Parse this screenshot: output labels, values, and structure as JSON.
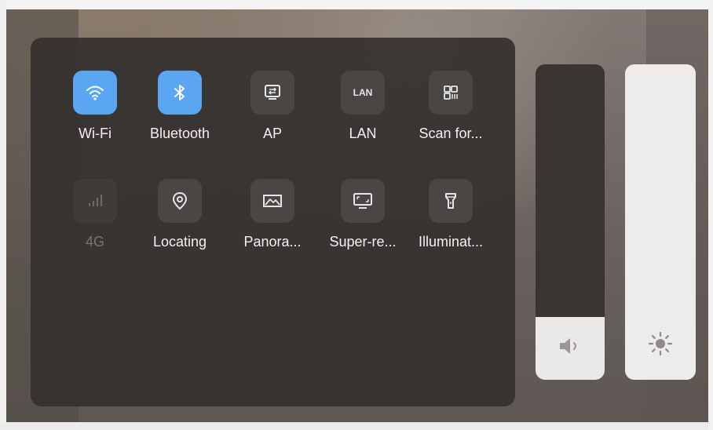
{
  "tiles": [
    {
      "name": "Wi-Fi",
      "icon": "wifi-icon",
      "active": true
    },
    {
      "name": "Bluetooth",
      "icon": "bluetooth-icon",
      "active": true
    },
    {
      "name": "AP",
      "icon": "hotspot-icon",
      "active": false
    },
    {
      "name": "LAN",
      "icon": "lan-icon",
      "icon_text": "LAN",
      "active": false
    },
    {
      "name": "Scan for...",
      "icon": "qr-scan-icon",
      "active": false
    },
    {
      "name": "4G",
      "icon": "signal-icon",
      "active": false,
      "disabled": true
    },
    {
      "name": "Locating",
      "icon": "location-icon",
      "active": false
    },
    {
      "name": "Panora...",
      "icon": "panorama-icon",
      "active": false
    },
    {
      "name": "Super-re...",
      "icon": "super-resolution-icon",
      "active": false
    },
    {
      "name": "Illuminat...",
      "icon": "flashlight-icon",
      "active": false
    }
  ],
  "sliders": {
    "volume": {
      "icon": "speaker-icon",
      "level": 0.2
    },
    "brightness": {
      "icon": "sun-icon",
      "level": 1.0
    }
  },
  "colors": {
    "active": "#5aa6f2",
    "panel": "#34302e"
  }
}
